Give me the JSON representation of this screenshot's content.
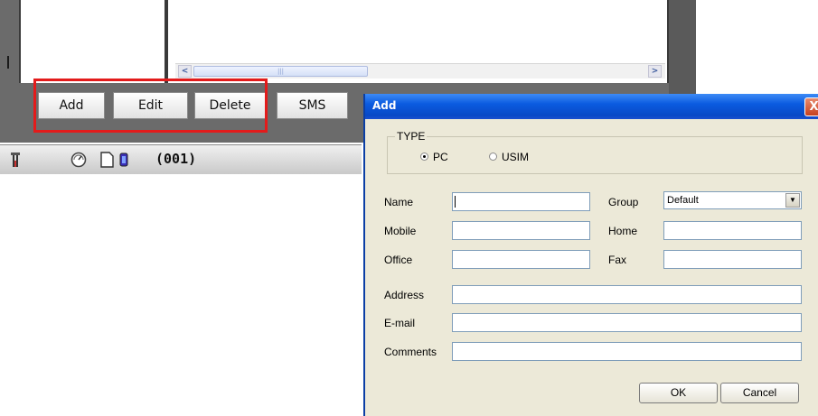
{
  "app": {
    "buttons": {
      "add": "Add",
      "edit": "Edit",
      "delete": "Delete",
      "sms": "SMS"
    },
    "status": {
      "code": "(001)",
      "icons": [
        "signal-antenna-icon",
        "gauge-icon",
        "sim-card-icon",
        "battery-icon"
      ]
    },
    "scrollbar": {
      "left_arrow": "<",
      "right_arrow": ">",
      "thumb_grip": "|||"
    },
    "colors": {
      "highlight": "#e31b1b",
      "frame": "#6b6b6b"
    }
  },
  "dialog": {
    "title": "Add",
    "close_glyph": "X",
    "type": {
      "legend": "TYPE",
      "options": [
        "PC",
        "USIM"
      ],
      "selected": "PC"
    },
    "fields": {
      "name": {
        "label": "Name",
        "value": ""
      },
      "group": {
        "label": "Group",
        "value": "Default"
      },
      "mobile": {
        "label": "Mobile",
        "value": ""
      },
      "home": {
        "label": "Home",
        "value": ""
      },
      "office": {
        "label": "Office",
        "value": ""
      },
      "fax": {
        "label": "Fax",
        "value": ""
      },
      "address": {
        "label": "Address",
        "value": ""
      },
      "email": {
        "label": "E-mail",
        "value": ""
      },
      "comments": {
        "label": "Comments",
        "value": ""
      }
    },
    "buttons": {
      "ok": "OK",
      "cancel": "Cancel"
    },
    "colors": {
      "titlebar": "#0b5be0",
      "body": "#ece9d8"
    }
  }
}
